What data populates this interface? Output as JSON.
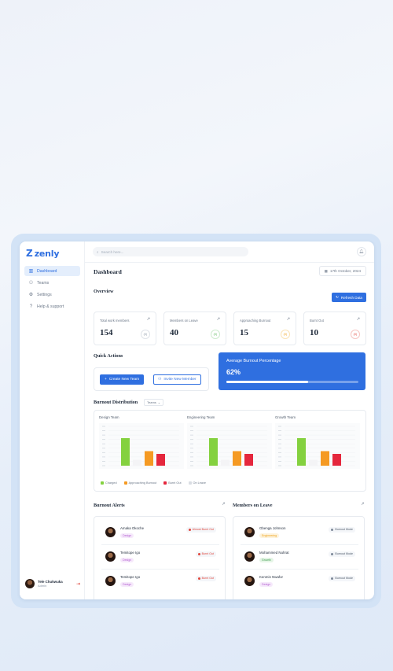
{
  "app": {
    "logo_mark": "Z",
    "logo_text": "zenly"
  },
  "sidebar": {
    "items": [
      {
        "label": "Dashboard",
        "icon": "bar-chart-icon",
        "glyph": "▥",
        "active": true
      },
      {
        "label": "Teams",
        "icon": "users-icon",
        "glyph": "⚇",
        "active": false
      },
      {
        "label": "Settings",
        "icon": "gear-icon",
        "glyph": "⚙",
        "active": false
      },
      {
        "label": "Help & support",
        "icon": "help-icon",
        "glyph": "?",
        "active": false
      }
    ],
    "user": {
      "name": "Tele Chukwuka",
      "role": "Admin"
    }
  },
  "topbar": {
    "search_placeholder": "Search here..."
  },
  "header": {
    "title": "Dashboard",
    "date": "17th October, 2024"
  },
  "overview": {
    "title": "Overview",
    "refresh_label": "Refresh Data",
    "stats": [
      {
        "label": "Total work members",
        "value": "154",
        "badge": "(0)",
        "color": "#8a95a5"
      },
      {
        "label": "Members on Leave",
        "value": "40",
        "badge": "(0)",
        "color": "#5cb85c"
      },
      {
        "label": "Approaching Burnout",
        "value": "15",
        "badge": "(0)",
        "color": "#f0a31a"
      },
      {
        "label": "Burnt Out",
        "value": "10",
        "badge": "(0)",
        "color": "#e0463c"
      }
    ]
  },
  "quick_actions": {
    "title": "Quick Actions",
    "create_label": "Create New Team",
    "invite_label": "Invite New Member"
  },
  "average_burnout": {
    "label": "Average Burnout Percentage",
    "value": "62%",
    "fraction": 0.62
  },
  "burnout_distribution": {
    "title": "Burnout Distribution",
    "filter": "Teams"
  },
  "chart_data": {
    "type": "bar",
    "charts": [
      {
        "title": "Design Team",
        "values": [
          70,
          15,
          37,
          30
        ]
      },
      {
        "title": "Engineering Team",
        "values": [
          70,
          15,
          37,
          30
        ]
      },
      {
        "title": "Growth Team",
        "values": [
          70,
          15,
          37,
          30
        ]
      }
    ],
    "categories": [
      "Charged",
      "Approaching Burnout",
      "Burnt Out",
      "On Leave"
    ],
    "bar_colors": [
      "#84d13f",
      "#f4f4f6",
      "#f59a23",
      "#e5273d"
    ],
    "legend": [
      {
        "name": "Charged",
        "color": "#84d13f"
      },
      {
        "name": "Approaching Burnout",
        "color": "#f59a23"
      },
      {
        "name": "Burnt Out",
        "color": "#e5273d"
      },
      {
        "name": "On Leave",
        "color": "#d9dde3"
      }
    ],
    "ylim": [
      0,
      100
    ]
  },
  "burnout_alerts": {
    "title": "Burnout Alerts",
    "rows": [
      {
        "name": "Amaka Okoche",
        "tag": "Design",
        "status": "Almost Burnt Out",
        "status_color": "#e0463c"
      },
      {
        "name": "Temitope Igo",
        "tag": "Design",
        "status": "Burnt Out",
        "status_color": "#e0463c"
      },
      {
        "name": "Temitope Igo",
        "tag": "Design",
        "status": "Burnt Out",
        "status_color": "#e0463c"
      }
    ]
  },
  "members_on_leave": {
    "title": "Members on Leave",
    "rows": [
      {
        "name": "Gbenga Johnson",
        "tag": "Engineering",
        "status": "Burnout Mode",
        "status_color": "#7d8898",
        "tag_color": "#f0a31a",
        "tag_bg": "#fdf3dd"
      },
      {
        "name": "Mohammed Nuhrat",
        "tag": "Growth",
        "status": "Burnout Mode",
        "status_color": "#7d8898",
        "tag_color": "#3b9a4b",
        "tag_bg": "#e5f5e6"
      },
      {
        "name": "Kenmin Nwafor",
        "tag": "Design",
        "status": "Burnout Mode",
        "status_color": "#7d8898",
        "tag_color": "#b35fd1",
        "tag_bg": "#f6e9fb"
      }
    ]
  }
}
